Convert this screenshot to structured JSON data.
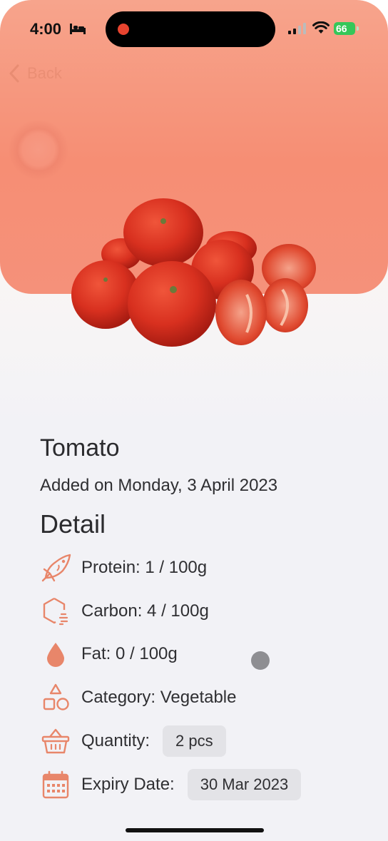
{
  "status_bar": {
    "time": "4:00",
    "battery": "66"
  },
  "nav": {
    "back_label": "Back"
  },
  "food": {
    "name": "Tomato",
    "added": "Added on Monday, 3 April 2023"
  },
  "detail": {
    "title": "Detail",
    "protein": "Protein: 1 / 100g",
    "carbon": "Carbon: 4 / 100g",
    "fat": "Fat: 0 / 100g",
    "category": "Category: Vegetable",
    "quantity_label": "Quantity:",
    "quantity_value": "2 pcs",
    "expiry_label": "Expiry Date:",
    "expiry_value": "30 Mar 2023"
  },
  "icons": {
    "protein": "fish-icon",
    "carbon": "hexagon-icon",
    "fat": "drop-icon",
    "category": "shapes-icon",
    "quantity": "basket-icon",
    "expiry": "calendar-icon"
  },
  "colors": {
    "accent": "#e8866a",
    "hero": "#f68e74"
  }
}
